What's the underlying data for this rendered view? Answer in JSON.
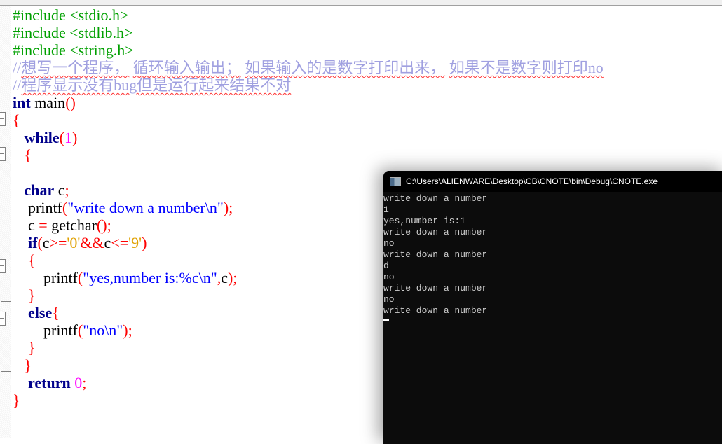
{
  "editor": {
    "lines": [
      {
        "parts": [
          {
            "t": "#include <stdio.h>",
            "c": "pp"
          }
        ]
      },
      {
        "parts": [
          {
            "t": "#include <stdlib.h>",
            "c": "pp"
          }
        ]
      },
      {
        "parts": [
          {
            "t": "#include <string.h>",
            "c": "pp"
          }
        ]
      },
      {
        "parts": [
          {
            "t": "//",
            "c": "cm"
          },
          {
            "t": "想写一个程序，",
            "c": "cm squig"
          },
          {
            "t": " ",
            "c": "cm"
          },
          {
            "t": "循环输入输出；",
            "c": "cm squig"
          },
          {
            "t": " ",
            "c": "cm"
          },
          {
            "t": "如果输入的是数字打印出来，",
            "c": "cm squig"
          },
          {
            "t": " ",
            "c": "cm"
          },
          {
            "t": "如果不是数字则打印no",
            "c": "cm squig"
          }
        ]
      },
      {
        "parts": [
          {
            "t": "//",
            "c": "cm"
          },
          {
            "t": "程序显示没有bug但是运行起来结果不对",
            "c": "cm squig"
          }
        ]
      },
      {
        "parts": [
          {
            "t": "int",
            "c": "kw"
          },
          {
            "t": " main",
            "c": "id"
          },
          {
            "t": "()",
            "c": "op"
          }
        ]
      },
      {
        "parts": [
          {
            "t": "{",
            "c": "op"
          }
        ]
      },
      {
        "parts": [
          {
            "t": "   ",
            "c": "id"
          },
          {
            "t": "while",
            "c": "kw"
          },
          {
            "t": "(",
            "c": "op"
          },
          {
            "t": "1",
            "c": "num"
          },
          {
            "t": ")",
            "c": "op"
          }
        ]
      },
      {
        "parts": [
          {
            "t": "   ",
            "c": "id"
          },
          {
            "t": "{",
            "c": "op"
          }
        ]
      },
      {
        "parts": [
          {
            "t": "",
            "c": "id"
          }
        ]
      },
      {
        "parts": [
          {
            "t": "   ",
            "c": "id"
          },
          {
            "t": "char",
            "c": "kw"
          },
          {
            "t": " c",
            "c": "id"
          },
          {
            "t": ";",
            "c": "op"
          }
        ]
      },
      {
        "parts": [
          {
            "t": "    printf",
            "c": "id"
          },
          {
            "t": "(",
            "c": "op"
          },
          {
            "t": "\"write down a number\\n\"",
            "c": "str"
          },
          {
            "t": ");",
            "c": "op"
          }
        ]
      },
      {
        "parts": [
          {
            "t": "    c ",
            "c": "id"
          },
          {
            "t": "=",
            "c": "op"
          },
          {
            "t": " getchar",
            "c": "id"
          },
          {
            "t": "();",
            "c": "op"
          }
        ]
      },
      {
        "parts": [
          {
            "t": "    ",
            "c": "id"
          },
          {
            "t": "if",
            "c": "kw"
          },
          {
            "t": "(",
            "c": "op"
          },
          {
            "t": "c",
            "c": "id"
          },
          {
            "t": ">=",
            "c": "op"
          },
          {
            "t": "'0'",
            "c": "chr"
          },
          {
            "t": "&&",
            "c": "op"
          },
          {
            "t": "c",
            "c": "id"
          },
          {
            "t": "<=",
            "c": "op"
          },
          {
            "t": "'9'",
            "c": "chr"
          },
          {
            "t": ")",
            "c": "op"
          }
        ]
      },
      {
        "parts": [
          {
            "t": "    ",
            "c": "id"
          },
          {
            "t": "{",
            "c": "op"
          }
        ]
      },
      {
        "parts": [
          {
            "t": "        printf",
            "c": "id"
          },
          {
            "t": "(",
            "c": "op"
          },
          {
            "t": "\"yes,number is:%c\\n\"",
            "c": "str"
          },
          {
            "t": ",",
            "c": "op"
          },
          {
            "t": "c",
            "c": "id"
          },
          {
            "t": ");",
            "c": "op"
          }
        ]
      },
      {
        "parts": [
          {
            "t": "    ",
            "c": "id"
          },
          {
            "t": "}",
            "c": "op"
          }
        ]
      },
      {
        "parts": [
          {
            "t": "    ",
            "c": "id"
          },
          {
            "t": "else",
            "c": "kw"
          },
          {
            "t": "{",
            "c": "op"
          }
        ]
      },
      {
        "parts": [
          {
            "t": "        printf",
            "c": "id"
          },
          {
            "t": "(",
            "c": "op"
          },
          {
            "t": "\"no\\n\"",
            "c": "str"
          },
          {
            "t": ");",
            "c": "op"
          }
        ]
      },
      {
        "parts": [
          {
            "t": "    ",
            "c": "id"
          },
          {
            "t": "}",
            "c": "op"
          }
        ]
      },
      {
        "parts": [
          {
            "t": "   ",
            "c": "id"
          },
          {
            "t": "}",
            "c": "op"
          }
        ]
      },
      {
        "parts": [
          {
            "t": "    ",
            "c": "id"
          },
          {
            "t": "return",
            "c": "kw"
          },
          {
            "t": " ",
            "c": "id"
          },
          {
            "t": "0",
            "c": "num"
          },
          {
            "t": ";",
            "c": "op"
          }
        ]
      },
      {
        "parts": [
          {
            "t": "}",
            "c": "op"
          }
        ]
      }
    ]
  },
  "console": {
    "title": "C:\\Users\\ALIENWARE\\Desktop\\CB\\CNOTE\\bin\\Debug\\CNOTE.exe",
    "icon": "console-window-icon",
    "output": [
      "write down a number",
      "1",
      "yes,number is:1",
      "write down a number",
      "no",
      "write down a number",
      "d",
      "no",
      "write down a number",
      "no",
      "write down a number"
    ]
  }
}
